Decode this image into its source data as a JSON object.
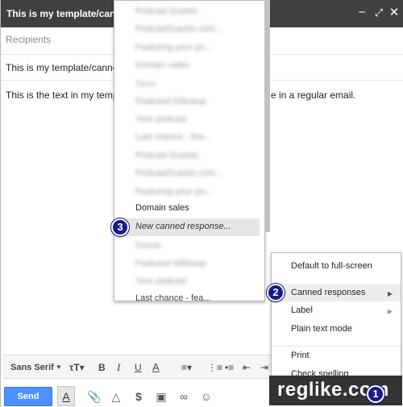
{
  "compose": {
    "title": "This is my template/canned response",
    "recipients_placeholder": "Recipients",
    "subject": "This is my template/canned response",
    "body_left": "This is the text in my template",
    "body_right": "e in a regular email."
  },
  "header_icons": [
    "minimize-icon",
    "popout-icon",
    "close-icon"
  ],
  "format_toolbar": {
    "font": "Sans Serif",
    "items": [
      "font-size-icon",
      "bold-icon",
      "italic-icon",
      "underline-icon",
      "text-color-icon",
      "align-icon",
      "numbered-list-icon",
      "bulleted-list-icon",
      "indent-less-icon",
      "indent-more-icon"
    ],
    "bold": "B",
    "italic": "I",
    "underline": "U",
    "text_color": "A"
  },
  "bottom_bar": {
    "send_label": "Send",
    "format_toggle": "A",
    "money": "$"
  },
  "templates_menu": {
    "insert_items": [
      "Podcast Guests",
      "PodcastGuests.com...",
      "Featuring your po...",
      "Domain sales"
    ],
    "save_header": "Save",
    "save_items": [
      "Featured followup",
      "Your podcast",
      "Last chance - fea...",
      "Podcast Guests",
      "PodcastGuests.com...",
      "Featuring your po..."
    ],
    "domain_sales": "Domain sales",
    "new_response": "New canned response...",
    "delete_header": "Delete",
    "delete_items": [
      "Featured followup",
      "Your podcast"
    ],
    "last_item": "Last chance - fea..."
  },
  "options_menu": {
    "items": [
      "Default to full-screen",
      "Canned responses",
      "Label",
      "Plain text mode",
      "Print",
      "Check spelling"
    ],
    "submenu_arrow": "▶"
  },
  "badges": [
    "1",
    "2",
    "3"
  ],
  "watermark": "reglike.com",
  "colors": {
    "header_bg": "#404040",
    "send_bg": "#4d90fe",
    "badge_bg": "#1a1a8c"
  }
}
